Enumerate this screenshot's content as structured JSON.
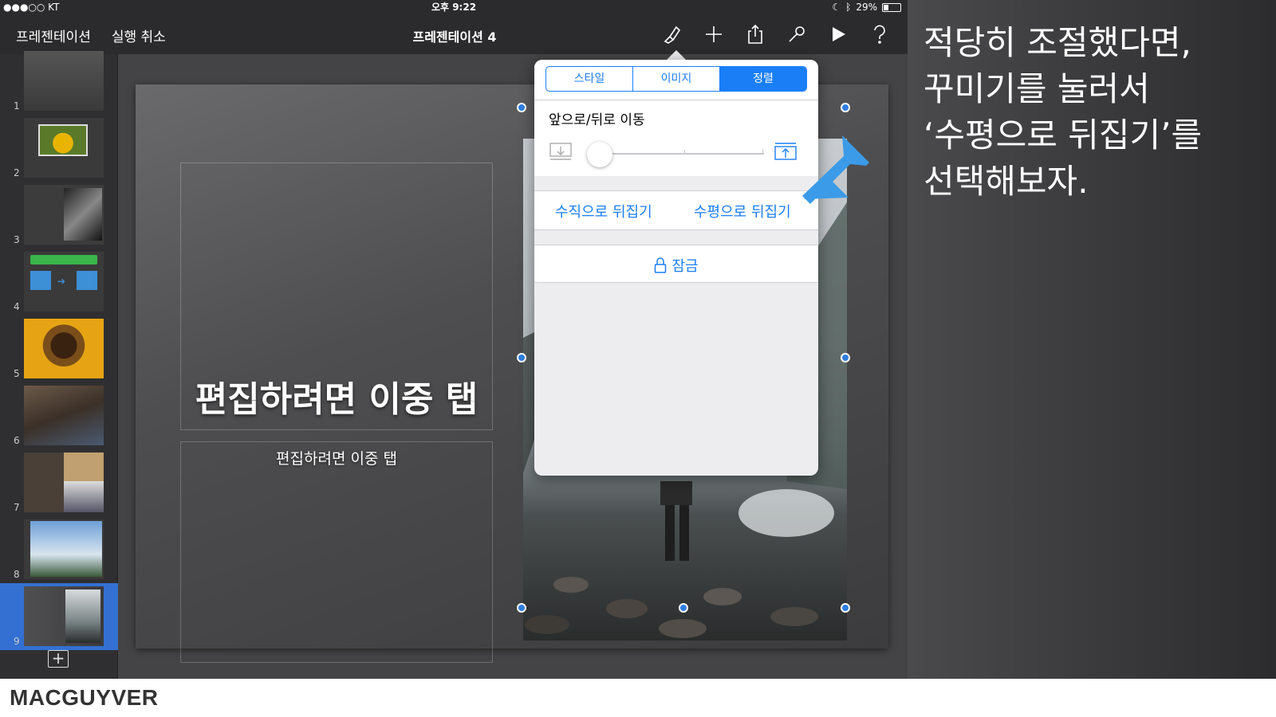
{
  "status": {
    "carrier": "●●●○○ KT",
    "time": "오후 9:22",
    "battery": "29%",
    "battery_level": 0.29
  },
  "toolbar": {
    "back_label": "프레젠테이션",
    "undo_label": "실행 취소",
    "title": "프레젠테이션 4",
    "icons": [
      "paintbrush-icon",
      "plus-icon",
      "share-icon",
      "wrench-icon",
      "play-icon",
      "help-icon"
    ]
  },
  "sidebar": {
    "slides": [
      {
        "num": "1"
      },
      {
        "num": "2"
      },
      {
        "num": "3"
      },
      {
        "num": "4"
      },
      {
        "num": "5"
      },
      {
        "num": "6"
      },
      {
        "num": "7"
      },
      {
        "num": "8"
      },
      {
        "num": "9"
      }
    ],
    "selected_slide": "9"
  },
  "slide": {
    "title_placeholder": "편집하려면 이중 탭",
    "body_placeholder": "편집하려면 이중 탭"
  },
  "popover": {
    "tabs": [
      {
        "label": "스타일",
        "active": false
      },
      {
        "label": "이미지",
        "active": false
      },
      {
        "label": "정렬",
        "active": true
      }
    ],
    "arrange_title": "앞으로/뒤로 이동",
    "flip_vertical": "수직으로 뒤집기",
    "flip_horizontal": "수평으로 뒤집기",
    "lock": "잠금"
  },
  "caption": {
    "lines": [
      "적당히 조절했다면,",
      "꾸미기를 눌러서",
      "‘수평으로 뒤집기’를",
      "선택해보자."
    ]
  },
  "footer": {
    "brand": "MACGUYVER"
  },
  "colors": {
    "accent": "#1a7ef7",
    "selected_slide": "#3470d1",
    "arrow": "#3b9be8"
  }
}
